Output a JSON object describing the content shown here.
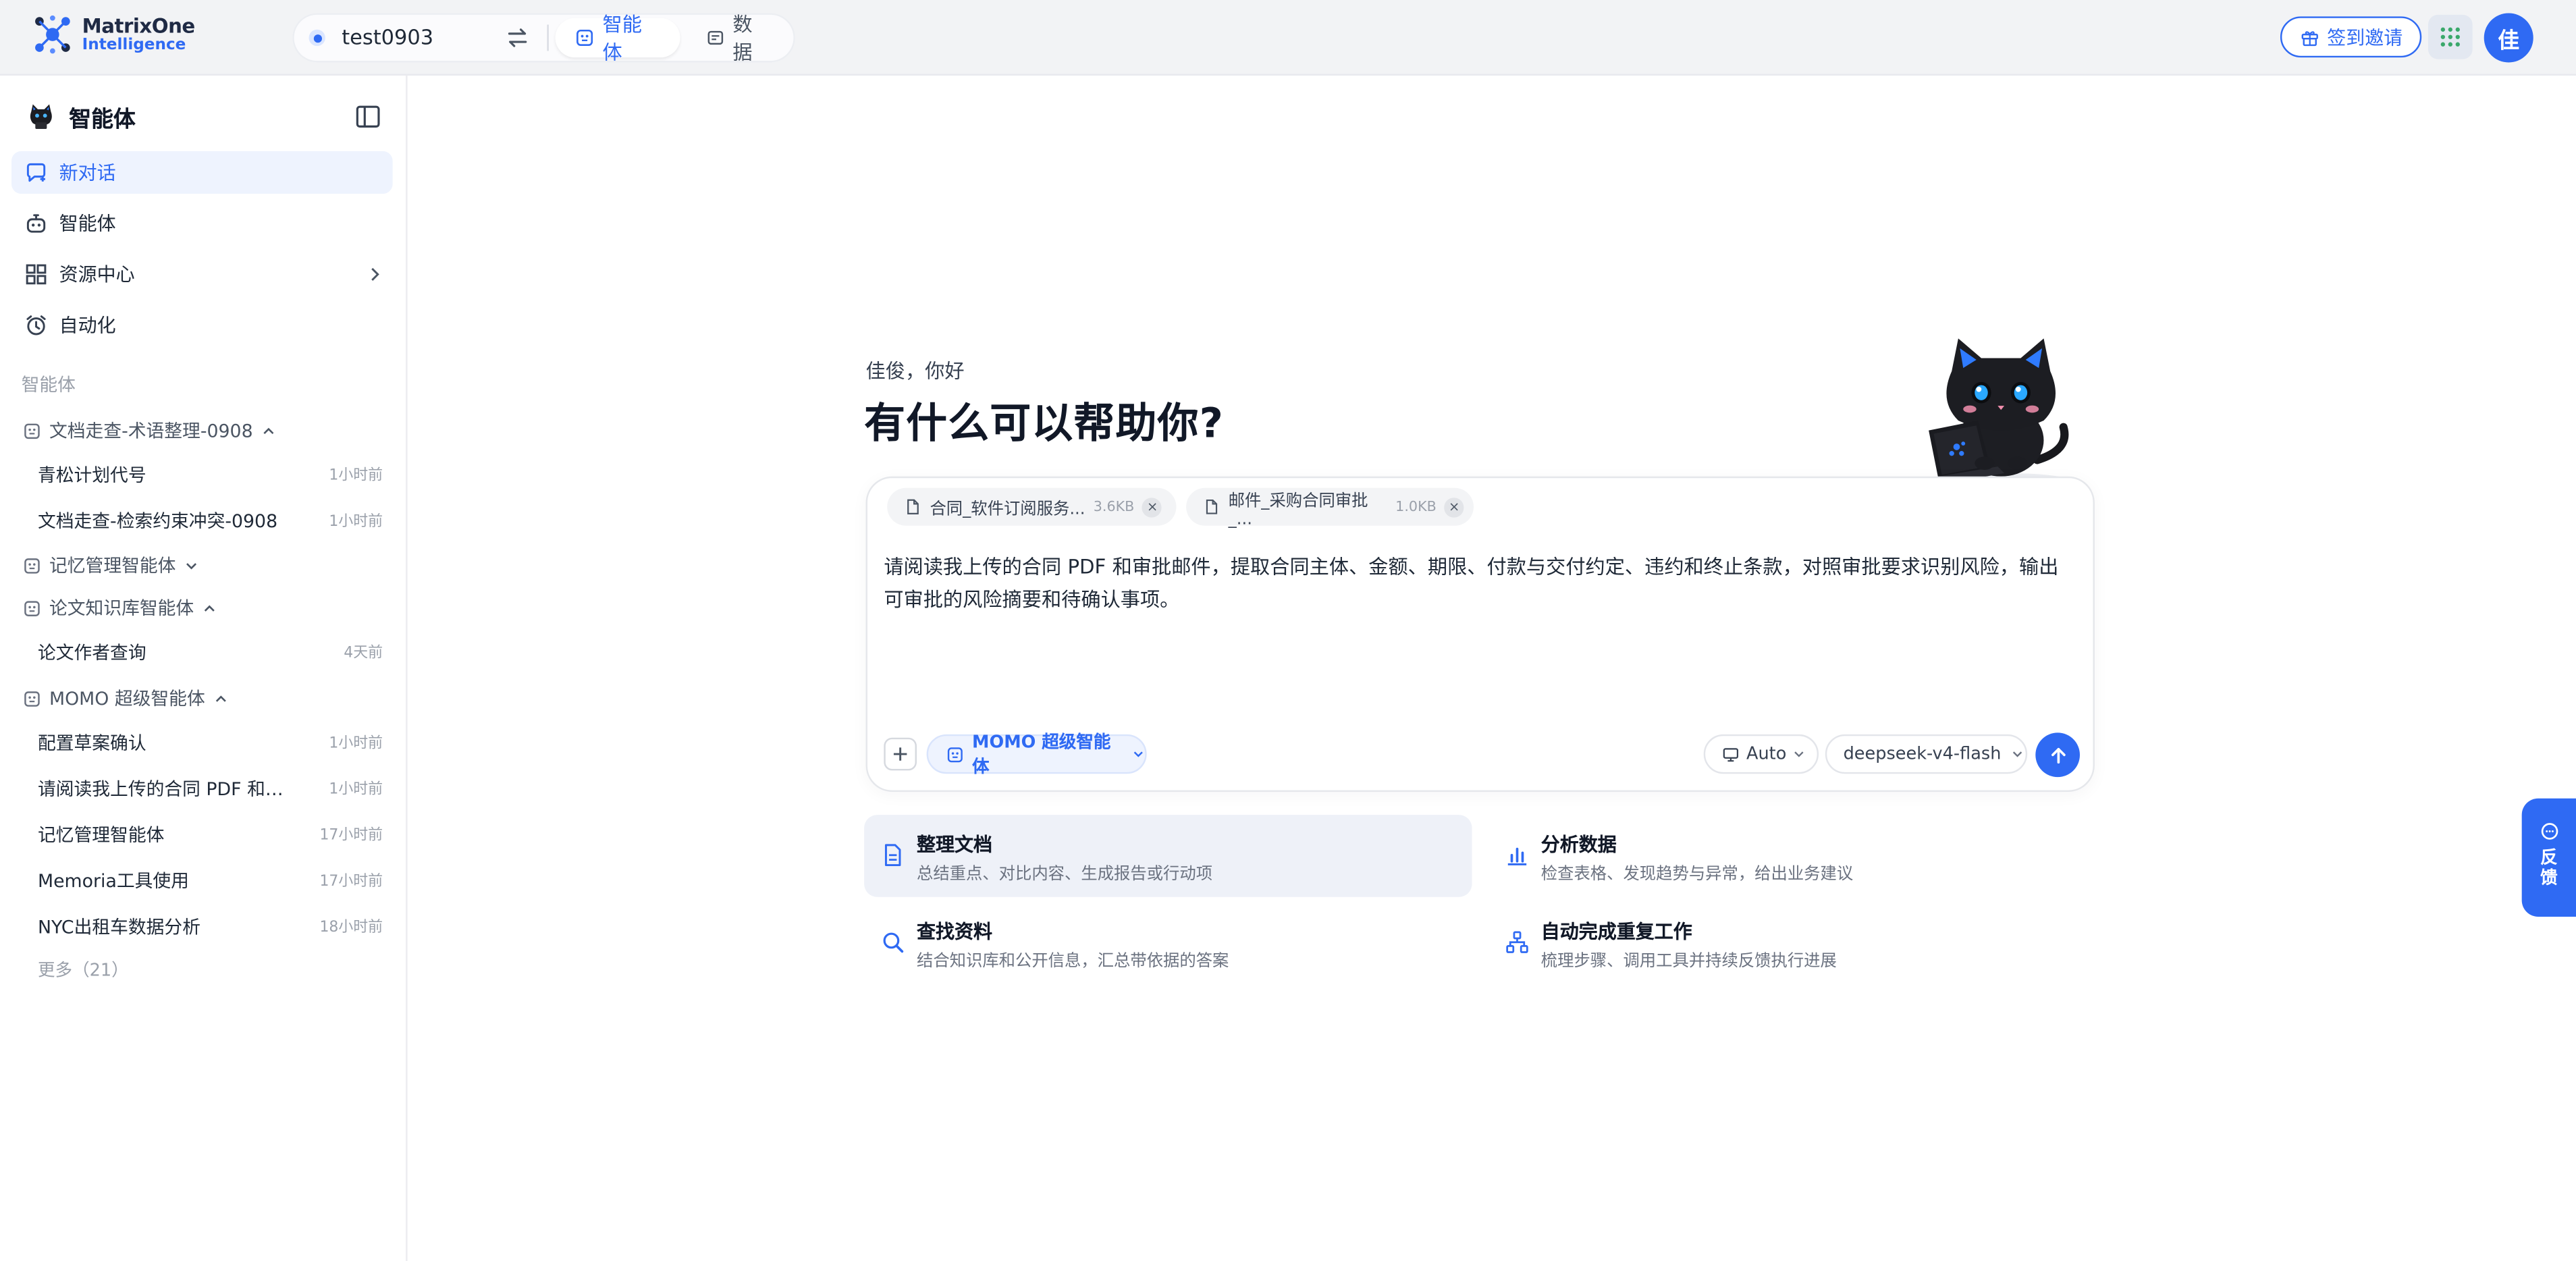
{
  "brand": {
    "line1": "MatrixOne",
    "line2": "Intelligence"
  },
  "workspace": {
    "name": "test0903"
  },
  "top_tabs": [
    {
      "label": "智能体",
      "icon": "agent-icon"
    },
    {
      "label": "数据",
      "icon": "data-icon"
    }
  ],
  "header": {
    "checkin_label": "签到邀请",
    "avatar_text": "佳"
  },
  "sidebar": {
    "title": "智能体",
    "nav": [
      {
        "label": "新对话",
        "icon": "new-chat-icon"
      },
      {
        "label": "智能体",
        "icon": "robot-icon"
      },
      {
        "label": "资源中心",
        "icon": "grid-icon"
      },
      {
        "label": "自动化",
        "icon": "alarm-clock-icon"
      }
    ],
    "section_label": "智能体",
    "groups": [
      {
        "name": "文档走查-术语整理-0908",
        "items": [
          {
            "title": "青松计划代号",
            "time": "1小时前"
          },
          {
            "title": "文档走查-检索约束冲突-0908",
            "time": "1小时前"
          }
        ]
      },
      {
        "name": "记忆管理智能体",
        "items": []
      },
      {
        "name": "论文知识库智能体",
        "items": [
          {
            "title": "论文作者查询",
            "time": "4天前"
          }
        ]
      },
      {
        "name": "MOMO 超级智能体",
        "items": [
          {
            "title": "配置草案确认",
            "time": "1小时前"
          },
          {
            "title": "请阅读我上传的合同 PDF 和审批邮件，提取合同主体、金额、期限、付款与交付约定、违约和终止条款，对照审批要求识别风险，输出可审批的风险摘要和待确认事项。",
            "time": "1小时前"
          },
          {
            "title": "记忆管理智能体",
            "time": "17小时前"
          },
          {
            "title": "Memoria工具使用",
            "time": "17小时前"
          },
          {
            "title": "NYC出租车数据分析",
            "time": "18小时前"
          }
        ]
      }
    ],
    "more_label": "更多（21）"
  },
  "main": {
    "greeting": "佳俊，你好",
    "headline": "有什么可以帮助你?",
    "attachments": [
      {
        "name": "合同_软件订阅服务...",
        "size": "3.6KB"
      },
      {
        "name": "邮件_采购合同审批_...",
        "size": "1.0KB"
      }
    ],
    "prompt": "请阅读我上传的合同 PDF 和审批邮件，提取合同主体、金额、期限、付款与交付约定、违约和终止条款，对照审批要求识别风险，输出可审批的风险摘要和待确认事项。",
    "agent_selector": "MOMO 超级智能体",
    "mode_selector": "Auto",
    "model_selector": "deepseek-v4-flash",
    "suggestions": [
      {
        "title": "整理文档",
        "desc": "总结重点、对比内容、生成报告或行动项",
        "icon": "document-icon"
      },
      {
        "title": "分析数据",
        "desc": "检查表格、发现趋势与异常，给出业务建议",
        "icon": "bar-chart-icon"
      },
      {
        "title": "查找资料",
        "desc": "结合知识库和公开信息，汇总带依据的答案",
        "icon": "search-icon"
      },
      {
        "title": "自动完成重复工作",
        "desc": "梳理步骤、调用工具并持续反馈执行进展",
        "icon": "workflow-icon"
      }
    ]
  },
  "feedback_label": "反馈",
  "colors": {
    "accent": "#2f6af3",
    "sidebar_active_bg": "#eef3fe",
    "topbar_bg": "#f2f3f5"
  }
}
